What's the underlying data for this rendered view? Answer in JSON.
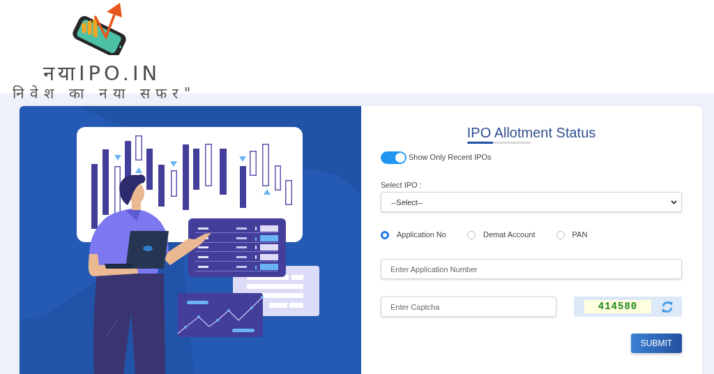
{
  "logo": {
    "name": "नयाIPO.IN",
    "tagline": "निवेश का नया सफर\""
  },
  "form": {
    "title": "IPO Allotment Status",
    "recent_toggle": {
      "label": "Show Only Recent IPOs",
      "on": true
    },
    "select_ipo": {
      "label": "Select IPO :",
      "value": "--Select--"
    },
    "search_by": [
      {
        "label": "Application No",
        "selected": true
      },
      {
        "label": "Demat Account",
        "selected": false
      },
      {
        "label": "PAN",
        "selected": false
      }
    ],
    "application_field": {
      "placeholder": "Enter Application Number"
    },
    "captcha_field": {
      "placeholder": "Enter Captcha"
    },
    "captcha_code": "414580",
    "submit": "SUBMIT"
  }
}
